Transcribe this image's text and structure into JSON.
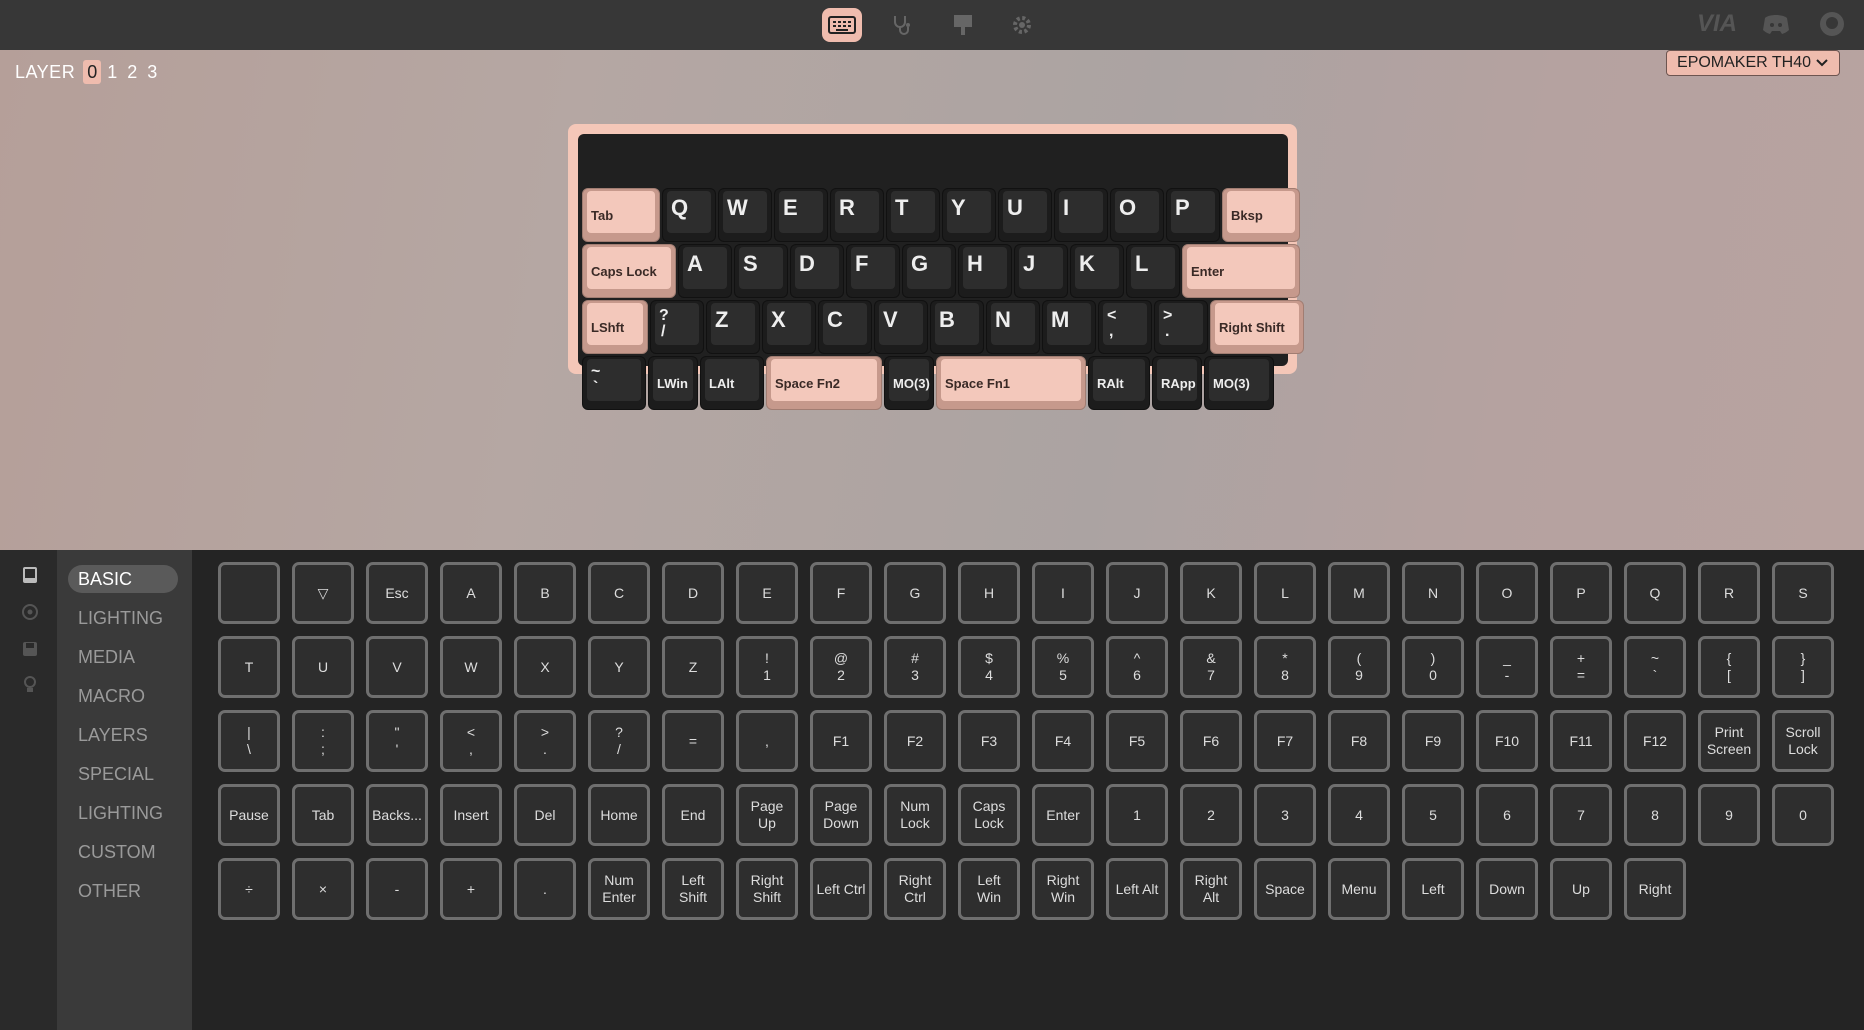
{
  "nav": {
    "tabs": [
      {
        "name": "keyboard-icon",
        "active": true
      },
      {
        "name": "stethoscope-icon",
        "active": false
      },
      {
        "name": "design-icon",
        "active": false
      },
      {
        "name": "settings-icon",
        "active": false
      }
    ],
    "brand": "VIA",
    "accent": "#efbcae"
  },
  "layer": {
    "label": "LAYER",
    "items": [
      "0",
      "1",
      "2",
      "3"
    ],
    "selected": "0"
  },
  "device": {
    "name": "EPOMAKER TH40"
  },
  "keyboard": {
    "rows": [
      [
        {
          "t": "Tab",
          "pink": true
        },
        {
          "t": "Q"
        },
        {
          "t": "W"
        },
        {
          "t": "E"
        },
        {
          "t": "R"
        },
        {
          "t": "T"
        },
        {
          "t": "Y"
        },
        {
          "t": "U"
        },
        {
          "t": "I"
        },
        {
          "t": "O"
        },
        {
          "t": "P"
        },
        {
          "t": "Bksp",
          "pink": true
        }
      ],
      [
        {
          "t": "Caps Lock",
          "pink": true
        },
        {
          "t": "A"
        },
        {
          "t": "S"
        },
        {
          "t": "D"
        },
        {
          "t": "F"
        },
        {
          "t": "G"
        },
        {
          "t": "H"
        },
        {
          "t": "J"
        },
        {
          "t": "K"
        },
        {
          "t": "L"
        },
        {
          "t": "Enter",
          "pink": true
        }
      ],
      [
        {
          "t": "LShft",
          "pink": true
        },
        {
          "t": "?",
          "b": "/"
        },
        {
          "t": "Z"
        },
        {
          "t": "X"
        },
        {
          "t": "C"
        },
        {
          "t": "V"
        },
        {
          "t": "B"
        },
        {
          "t": "N"
        },
        {
          "t": "M"
        },
        {
          "t": "<",
          "b": ","
        },
        {
          "t": ">",
          "b": "."
        },
        {
          "t": "Right Shift",
          "pink": true
        }
      ],
      [
        {
          "t": "~",
          "b": "`"
        },
        {
          "t": "LWin"
        },
        {
          "t": "LAlt"
        },
        {
          "t": "Space Fn2",
          "pink": true
        },
        {
          "t": "MO(3)"
        },
        {
          "t": "Space Fn1",
          "pink": true
        },
        {
          "t": "RAlt"
        },
        {
          "t": "RApp"
        },
        {
          "t": "MO(3)"
        }
      ]
    ]
  },
  "sidebar": {
    "icons": [
      "keycap-icon",
      "target-icon",
      "save-icon",
      "lightbulb-icon"
    ],
    "categories": [
      "BASIC",
      "LIGHTING",
      "MEDIA",
      "MACRO",
      "LAYERS",
      "SPECIAL",
      "LIGHTING",
      "CUSTOM",
      "OTHER"
    ],
    "selected": "BASIC"
  },
  "keycodes": [
    [
      "",
      "▽",
      "Esc",
      "A",
      "B",
      "C",
      "D",
      "E",
      "F",
      "G",
      "H",
      "I",
      "J",
      "K",
      "L",
      "M",
      "N",
      "O",
      "P",
      "Q",
      "R",
      "S"
    ],
    [
      "T",
      "U",
      "V",
      "W",
      "X",
      "Y",
      "Z",
      "!\n1",
      "@\n2",
      "#\n3",
      "$\n4",
      "%\n5",
      "^\n6",
      "&\n7",
      "*\n8",
      "(\n9",
      ")\n0",
      "_\n-",
      "+\n=",
      "~\n`",
      "{\n[",
      "}\n]"
    ],
    [
      "|\n\\",
      ":\n;",
      "\"\n'",
      "<\n,",
      ">\n.",
      "?\n/",
      "=",
      ",",
      "F1",
      "F2",
      "F3",
      "F4",
      "F5",
      "F6",
      "F7",
      "F8",
      "F9",
      "F10",
      "F11",
      "F12",
      "Print\nScreen",
      "Scroll\nLock"
    ],
    [
      "Pause",
      "Tab",
      "Backs...",
      "Insert",
      "Del",
      "Home",
      "End",
      "Page\nUp",
      "Page\nDown",
      "Num\nLock",
      "Caps\nLock",
      "Enter",
      "1",
      "2",
      "3",
      "4",
      "5",
      "6",
      "7",
      "8",
      "9",
      "0"
    ],
    [
      "÷",
      "×",
      "-",
      "+",
      ".",
      "Num\nEnter",
      "Left\nShift",
      "Right\nShift",
      "Left Ctrl",
      "Right\nCtrl",
      "Left\nWin",
      "Right\nWin",
      "Left Alt",
      "Right\nAlt",
      "Space",
      "Menu",
      "Left",
      "Down",
      "Up",
      "Right"
    ]
  ]
}
